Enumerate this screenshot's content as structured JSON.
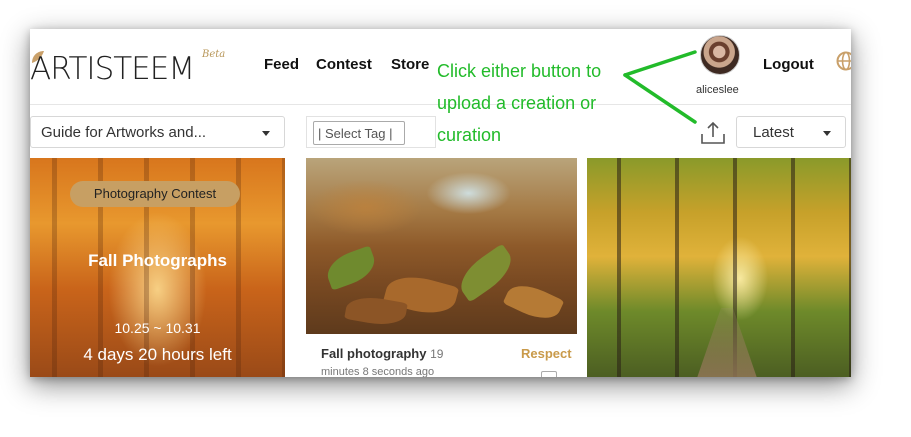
{
  "header": {
    "logo_text": "ARTISTEEM",
    "logo_badge": "Beta",
    "nav": {
      "feed": "Feed",
      "contest": "Contest",
      "store": "Store"
    },
    "username": "aliceslee",
    "logout_label": "Logout"
  },
  "filters": {
    "category_value": "Guide for Artworks and...",
    "tag_placeholder": "| Select Tag |",
    "sort_value": "Latest"
  },
  "contest_card": {
    "badge": "Photography Contest",
    "title": "Fall Photographs",
    "dates": "10.25 ~ 10.31",
    "time_left": "4 days 20 hours left"
  },
  "post_card": {
    "title": "Fall photography",
    "time_prefix": "19",
    "time_rest": "minutes 8 seconds ago",
    "action": "Respect"
  },
  "annotation": {
    "lines": [
      "Click either button to",
      "upload a creation or",
      "curation"
    ],
    "color": "#22bb2a"
  },
  "colors": {
    "accent_gold": "#c79f63",
    "respect": "#c99a4a"
  },
  "icons": [
    "globe-icon",
    "upload-icon",
    "chevron-down-icon",
    "comment-icon"
  ]
}
